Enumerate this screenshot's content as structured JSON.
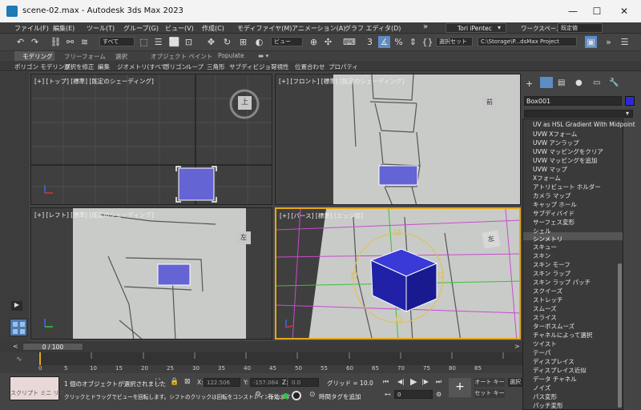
{
  "window": {
    "title": "scene-02.max - Autodesk 3ds Max 2023",
    "min": "—",
    "max": "☐",
    "close": "✕"
  },
  "menu": {
    "items": [
      "ファイル(F)",
      "編集(E)",
      "ツール(T)",
      "グループ(G)",
      "ビュー(V)",
      "作成(C)",
      "モディファイヤ(M)",
      "アニメーション(A)",
      "グラフ エディタ(D)"
    ],
    "more": "»",
    "user": "Tori iPentec",
    "workspace_label": "ワークスペース:",
    "workspace_value": "既定値"
  },
  "toolbar": {
    "select_filter": "すべて",
    "ref_coord": "ビュー",
    "selection_set": "選択セット",
    "project_path": "C:\\Storage\\P...dsMax Project"
  },
  "ribbon": {
    "tabs": [
      "モデリング",
      "フリーフォーム",
      "選択",
      "オブジェクト ペイント",
      "Populate"
    ],
    "tools": [
      "ポリゴン モデリング",
      "選択を修正",
      "編集",
      "ジオメトリ(すべて)",
      "ポリゴン",
      "ループ",
      "三角形",
      "サブディビジョン",
      "可視性",
      "位置合わせ",
      "プロパティ"
    ]
  },
  "viewports": {
    "top": {
      "label": "[+] [トップ] [標準] [既定のシェーディング]",
      "cube": "上"
    },
    "front": {
      "label": "[+] [フロント] [標準] [既定のシェーディング]",
      "cube": "前"
    },
    "left": {
      "label": "[+] [レフト] [標準] [既定のシェーディング]",
      "cube": "左"
    },
    "persp": {
      "label": "[+] [パース] [標準] [エッジ面]",
      "cube": "左"
    }
  },
  "command_panel": {
    "object_name": "Box001",
    "object_color": "#2b2bd6"
  },
  "modifier_list": {
    "items": [
      "UV as HSL Gradient With Midpoint",
      "UVW Xフォーム",
      "UVW アンラップ",
      "UVW マッピングをクリア",
      "UVW マッピングを追加",
      "UVW マップ",
      "Xフォーム",
      "アトリビュート ホルダー",
      "カメラ マップ",
      "キャップ ホール",
      "サブディバイド",
      "サーフェス変形",
      "シェル",
      "シンメトリ",
      "スキュー",
      "スキン",
      "スキン モーフ",
      "スキン ラップ",
      "スキン ラップ パッチ",
      "スクイーズ",
      "ストレッチ",
      "スムーズ",
      "スライス",
      "ターボスムーズ",
      "チャネルによって選択",
      "ツイスト",
      "テーパ",
      "ディスプレイス",
      "ディスプレイス近似",
      "データ チャネル",
      "ノイズ",
      "パス変形",
      "パッチ変形"
    ],
    "selected": "シンメトリ"
  },
  "timeline": {
    "frame": "0 / 100",
    "prev": "<",
    "next": ">",
    "ticks": [
      "0",
      "5",
      "10",
      "15",
      "20",
      "25",
      "30",
      "35",
      "40",
      "45",
      "50",
      "55",
      "60",
      "65",
      "70",
      "75",
      "80",
      "85"
    ]
  },
  "status": {
    "maxscript": "スクリプト ミニ リス",
    "selected_text": "1 個のオブジェクトが選択されました",
    "hint_text": "クリックとドラッグでビューを回転します。シフトのクリックは回転をコンストレイントします",
    "x_label": "X:",
    "x_value": "122.506",
    "y_label": "Y:",
    "y_value": "-157.064",
    "z_label": "Z:",
    "z_value": "0.0",
    "grid_text": "グリッド = 10.0",
    "enabled": "有効:",
    "addtime": "時間タグを追加",
    "auto_key": "オート キー",
    "set_key": "セット キー",
    "select_label": "選択",
    "frame_value": "0"
  }
}
